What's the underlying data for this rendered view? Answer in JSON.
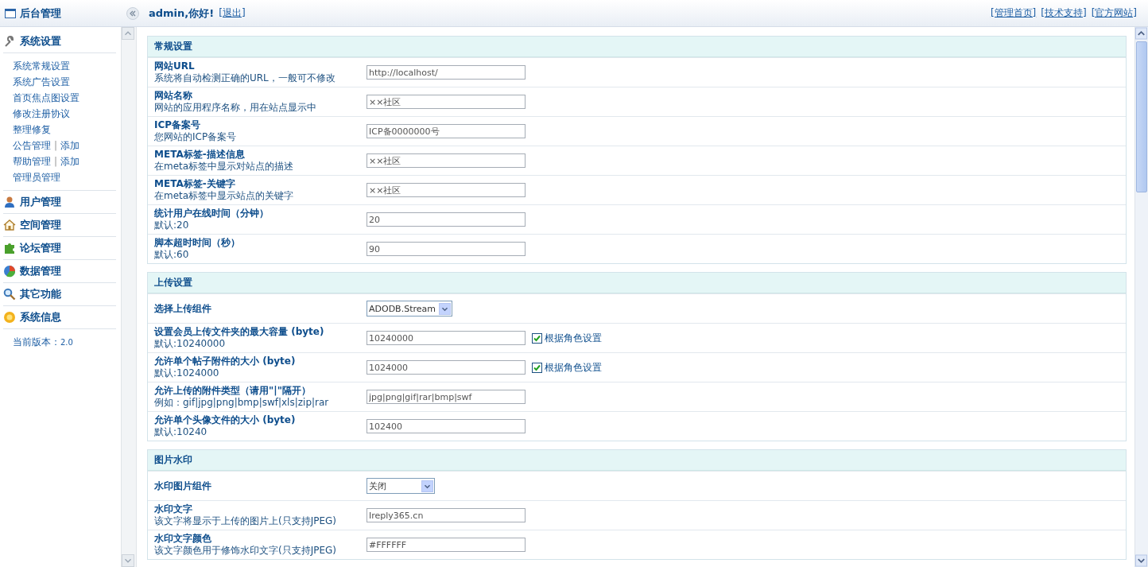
{
  "header": {
    "title": "后台管理",
    "greeting": "admin,你好!",
    "logout": "[退出]",
    "links": [
      "[管理首页]",
      "[技术支持]",
      "[官方网站]"
    ]
  },
  "sidebar": {
    "groups": [
      {
        "title": "系统设置",
        "items": [
          {
            "links": [
              "系统常规设置"
            ]
          },
          {
            "links": [
              "系统广告设置"
            ]
          },
          {
            "links": [
              "首页焦点图设置"
            ]
          },
          {
            "links": [
              "修改注册协议"
            ]
          },
          {
            "links": [
              "整理修复"
            ]
          },
          {
            "links": [
              "公告管理",
              "添加"
            ],
            "separator": "|"
          },
          {
            "links": [
              "帮助管理",
              "添加"
            ],
            "separator": "|"
          },
          {
            "links": [
              "管理员管理"
            ]
          }
        ]
      },
      {
        "title": "用户管理"
      },
      {
        "title": "空间管理"
      },
      {
        "title": "论坛管理"
      },
      {
        "title": "数据管理"
      },
      {
        "title": "其它功能"
      },
      {
        "title": "系统信息"
      }
    ],
    "version_label": "当前版本：",
    "version": "2.0"
  },
  "sections": [
    {
      "title": "常规设置",
      "rows": [
        {
          "kind": "text",
          "label": "网站URL",
          "hint": "系统将自动检测正确的URL，一般可不修改",
          "value": "http://localhost/"
        },
        {
          "kind": "text",
          "label": "网站名称",
          "hint": "网站的应用程序名称，用在站点显示中",
          "value": "××社区"
        },
        {
          "kind": "text",
          "label": "ICP备案号",
          "hint": "您网站的ICP备案号",
          "value": "ICP备0000000号"
        },
        {
          "kind": "text",
          "label": "META标签-描述信息",
          "hint": "在meta标签中显示对站点的描述",
          "value": "××社区"
        },
        {
          "kind": "text",
          "label": "META标签-关键字",
          "hint": "在meta标签中显示站点的关键字",
          "value": "××社区"
        },
        {
          "kind": "text",
          "label": "统计用户在线时间（分钟）",
          "hint": "默认:20",
          "value": "20"
        },
        {
          "kind": "text",
          "label": "脚本超时时间（秒）",
          "hint": "默认:60",
          "value": "90"
        }
      ]
    },
    {
      "title": "上传设置",
      "rows": [
        {
          "kind": "select",
          "label": "选择上传组件",
          "value": "ADODB.Stream"
        },
        {
          "kind": "text",
          "label": "设置会员上传文件夹的最大容量 (byte)",
          "hint": "默认:10240000",
          "value": "10240000",
          "checkbox": {
            "label": "根据角色设置",
            "checked": true
          }
        },
        {
          "kind": "text",
          "label": "允许单个帖子附件的大小 (byte)",
          "hint": "默认:1024000",
          "value": "1024000",
          "checkbox": {
            "label": "根据角色设置",
            "checked": true
          }
        },
        {
          "kind": "text",
          "label": "允许上传的附件类型（请用\"|\"隔开）",
          "hint": "例如：gif|jpg|png|bmp|swf|xls|zip|rar",
          "value": "jpg|png|gif|rar|bmp|swf"
        },
        {
          "kind": "text",
          "label": "允许单个头像文件的大小 (byte)",
          "hint": "默认:10240",
          "value": "102400"
        }
      ]
    },
    {
      "title": "图片水印",
      "rows": [
        {
          "kind": "select",
          "label": "水印图片组件",
          "value": "关闭"
        },
        {
          "kind": "text",
          "label": "水印文字",
          "hint": "该文字将显示于上传的图片上(只支持JPEG)",
          "value": "Ireply365.cn"
        },
        {
          "kind": "text",
          "label": "水印文字颜色",
          "hint": "该文字颜色用于修饰水印文字(只支持JPEG)",
          "value": "#FFFFFF"
        }
      ]
    }
  ]
}
